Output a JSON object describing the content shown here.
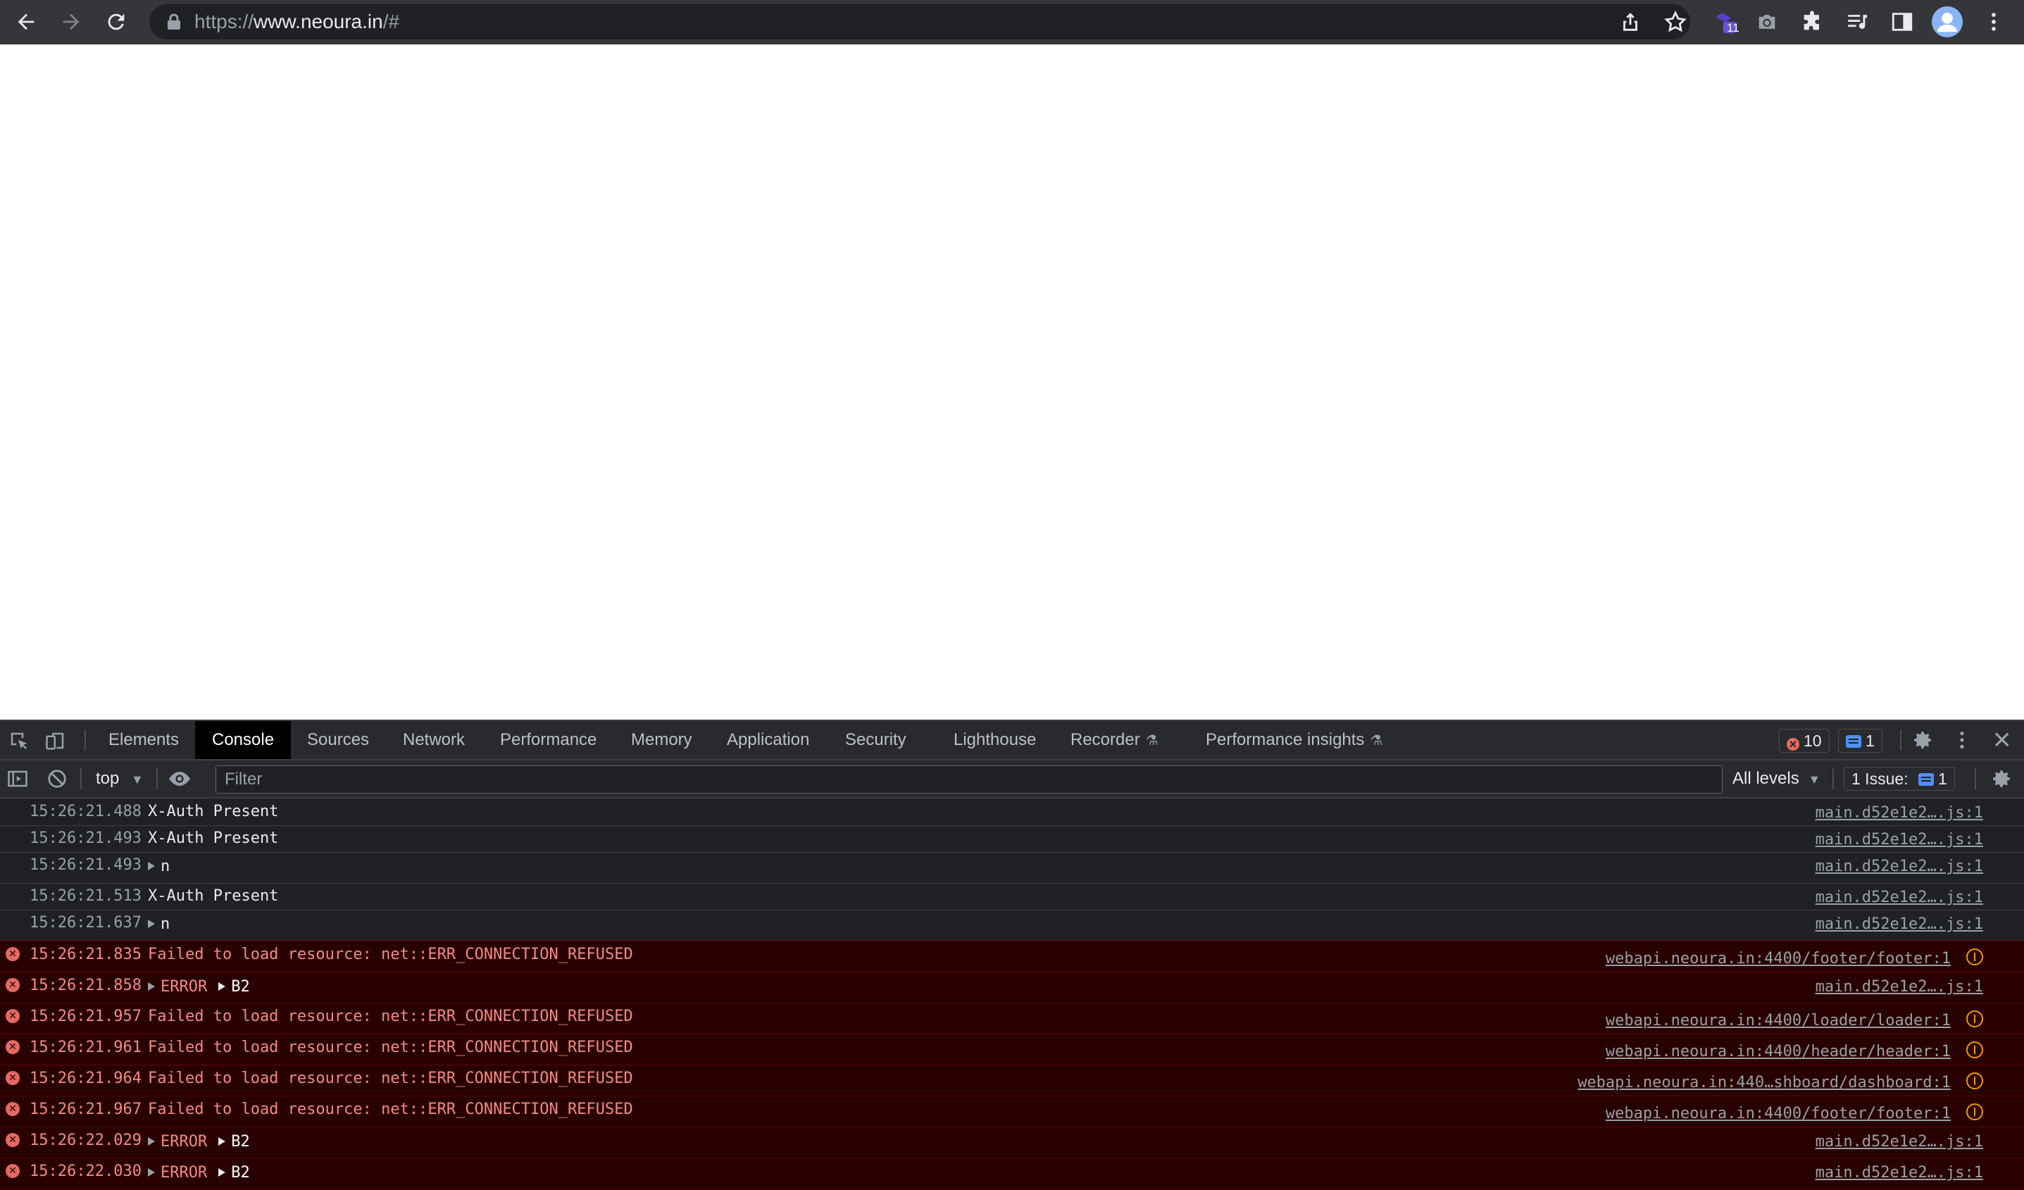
{
  "browser": {
    "url_prefix": "https://",
    "url_domain": "www.neoura.in",
    "url_suffix": "/#",
    "extension_badge": "11"
  },
  "devtools": {
    "tabs": [
      {
        "label": "Elements"
      },
      {
        "label": "Console"
      },
      {
        "label": "Sources"
      },
      {
        "label": "Network"
      },
      {
        "label": "Performance"
      },
      {
        "label": "Memory"
      },
      {
        "label": "Application"
      },
      {
        "label": "Security"
      },
      {
        "label": "Lighthouse"
      },
      {
        "label": "Recorder"
      },
      {
        "label": "Performance insights"
      }
    ],
    "active_tab": "Console",
    "error_count": "10",
    "message_count": "1",
    "console_toolbar": {
      "context": "top",
      "filter_placeholder": "Filter",
      "levels": "All levels",
      "issues_label": "1 Issue:",
      "issues_count": "1"
    },
    "console_rows": [
      {
        "time": "15:26:21.488",
        "message": "X-Auth Present",
        "source": "main.d52e1e2….js:1"
      },
      {
        "time": "15:26:21.493",
        "message": "X-Auth Present",
        "source": "main.d52e1e2….js:1"
      },
      {
        "time": "15:26:21.493",
        "message": "n",
        "source": "main.d52e1e2….js:1"
      },
      {
        "time": "15:26:21.513",
        "message": "X-Auth Present",
        "source": "main.d52e1e2….js:1"
      },
      {
        "time": "15:26:21.637",
        "message": "n",
        "source": "main.d52e1e2….js:1"
      },
      {
        "time": "15:26:21.835",
        "message": "Failed to load resource: net::ERR_CONNECTION_REFUSED",
        "source": "webapi.neoura.in:4400/footer/footer:1"
      },
      {
        "time": "15:26:21.858",
        "message": "ERROR",
        "message2": "B2",
        "source": "main.d52e1e2….js:1"
      },
      {
        "time": "15:26:21.957",
        "message": "Failed to load resource: net::ERR_CONNECTION_REFUSED",
        "source": "webapi.neoura.in:4400/loader/loader:1"
      },
      {
        "time": "15:26:21.961",
        "message": "Failed to load resource: net::ERR_CONNECTION_REFUSED",
        "source": "webapi.neoura.in:4400/header/header:1"
      },
      {
        "time": "15:26:21.964",
        "message": "Failed to load resource: net::ERR_CONNECTION_REFUSED",
        "source": "webapi.neoura.in:440…shboard/dashboard:1"
      },
      {
        "time": "15:26:21.967",
        "message": "Failed to load resource: net::ERR_CONNECTION_REFUSED",
        "source": "webapi.neoura.in:4400/footer/footer:1"
      },
      {
        "time": "15:26:22.029",
        "message": "ERROR",
        "message2": "B2",
        "source": "main.d52e1e2….js:1"
      },
      {
        "time": "15:26:22.030",
        "message": "ERROR",
        "message2": "B2",
        "source": "main.d52e1e2….js:1"
      }
    ]
  }
}
